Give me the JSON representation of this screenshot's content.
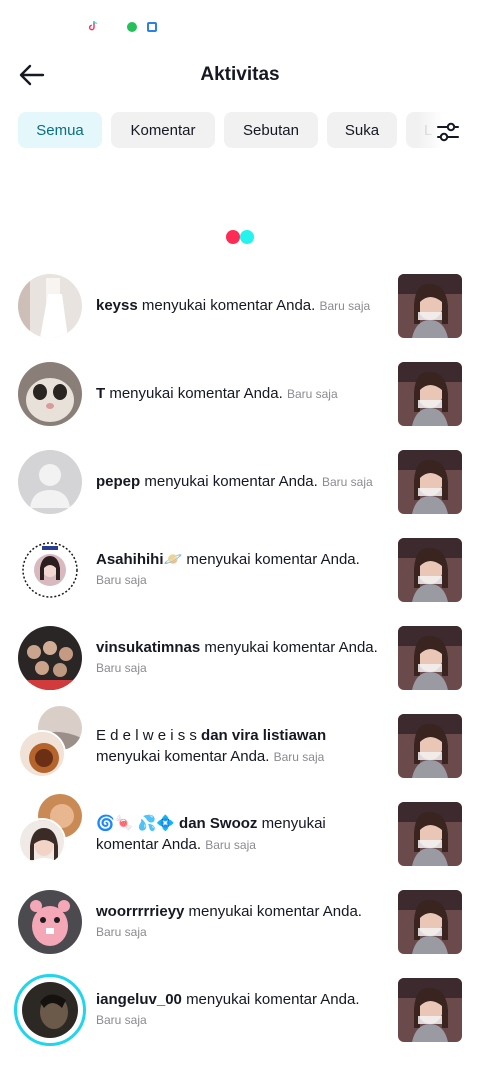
{
  "header": {
    "title": "Aktivitas"
  },
  "filters": [
    {
      "label": "Semua",
      "active": true
    },
    {
      "label": "Komentar",
      "active": false
    },
    {
      "label": "Sebutan",
      "active": false
    },
    {
      "label": "Suka",
      "active": false
    },
    {
      "label": "L",
      "active": false
    }
  ],
  "colors": {
    "active_chip_bg": "#e4f7fb",
    "active_chip_text": "#0a6f82",
    "chip_bg": "#f1f1f2",
    "loader_red": "#fe2c55",
    "loader_cyan": "#25f4ee",
    "ring": "#20d5ec"
  },
  "icons": {
    "back": "arrow-left-icon",
    "filter": "sliders-icon"
  },
  "notifications": [
    {
      "user": "keyss",
      "action": "menyukai komentar Anda.",
      "time": "Baru saja"
    },
    {
      "user": "T",
      "action": "menyukai komentar Anda.",
      "time": "Baru saja"
    },
    {
      "user": "pepep",
      "action": "menyukai komentar Anda.",
      "time": "Baru saja"
    },
    {
      "user": "Asahihihi🪐",
      "action": "menyukai komentar Anda.",
      "time": "Baru saja"
    },
    {
      "user": "vinsukatimnas",
      "action": "menyukai komentar Anda.",
      "time": "Baru saja"
    },
    {
      "user": "E d e l w e i s s",
      "joiner": "dan",
      "user2": "vira listiawan",
      "action": "menyukai komentar Anda.",
      "time": "Baru saja"
    },
    {
      "user": "🌀🍬 💦💠",
      "joiner": "dan",
      "user2": "Swooz",
      "action_a": "menyukai",
      "action_b": "komentar Anda.",
      "time": "Baru saja"
    },
    {
      "user": "woorrrrrieyy",
      "action": "menyukai komentar Anda.",
      "time": "Baru saja"
    },
    {
      "user": "iangeluv_00",
      "action": "menyukai komentar Anda.",
      "time": "Baru saja"
    }
  ]
}
